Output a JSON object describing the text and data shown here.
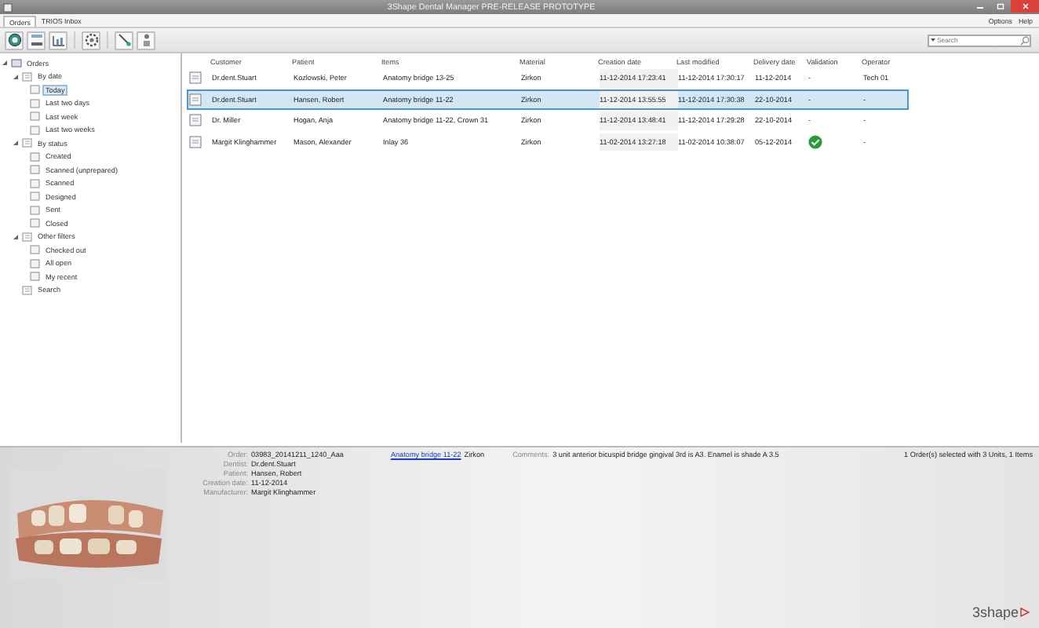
{
  "window": {
    "title": "3Shape Dental Manager PRE-RELEASE PROTOTYPE"
  },
  "tabs": [
    {
      "label": "Orders",
      "selected": true
    },
    {
      "label": "TRIOS Inbox",
      "selected": false
    }
  ],
  "menu": [
    "Options",
    "Help"
  ],
  "search": {
    "placeholder": "Search"
  },
  "tree": {
    "label": "Orders",
    "expanded": true,
    "selected": false,
    "children": [
      {
        "label": "By date",
        "expanded": true,
        "selected": false,
        "children": [
          {
            "label": "Today",
            "selected": true
          },
          {
            "label": "Last two days",
            "selected": false
          },
          {
            "label": "Last week",
            "selected": false
          },
          {
            "label": "Last two weeks",
            "selected": false
          }
        ]
      },
      {
        "label": "By status",
        "expanded": true,
        "selected": false,
        "children": [
          {
            "label": "Created",
            "selected": false
          },
          {
            "label": "Scanned (unprepared)",
            "selected": false
          },
          {
            "label": "Scanned",
            "selected": false
          },
          {
            "label": "Designed",
            "selected": false
          },
          {
            "label": "Sent",
            "selected": false
          },
          {
            "label": "Closed",
            "selected": false
          }
        ]
      },
      {
        "label": "Other filters",
        "expanded": true,
        "selected": false,
        "children": [
          {
            "label": "Checked out",
            "selected": false
          },
          {
            "label": "All open",
            "selected": false
          },
          {
            "label": "My recent",
            "selected": false
          }
        ]
      },
      {
        "label": "Search",
        "selected": false
      }
    ]
  },
  "table": {
    "columns": [
      "Customer",
      "Patient",
      "Items",
      "Material",
      "Creation date",
      "Last modified",
      "Delivery date",
      "Validation",
      "Operator"
    ],
    "rows": [
      {
        "selected": false,
        "cells": [
          "Dr.dent.Stuart",
          "Kozlowski, Peter",
          "Anatomy bridge 13-25",
          "Zirkon",
          "11-12-2014 17:23:41",
          "11-12-2014 17:30:17",
          "11-12-2014"
        ],
        "validation": {
          "kind": "text",
          "text": "-"
        },
        "operator": "Tech 01"
      },
      {
        "selected": true,
        "cells": [
          "Dr.dent.Stuart",
          "Hansen, Robert",
          "Anatomy bridge 11-22",
          "Zirkon",
          "11-12-2014 13:55:55",
          "11-12-2014 17:30:38",
          "22-10-2014"
        ],
        "validation": {
          "kind": "text",
          "text": "-"
        },
        "operator": "-"
      },
      {
        "selected": false,
        "cells": [
          "Dr. Miller",
          "Hogan, Anja",
          "Anatomy bridge 11-22, Crown 31",
          "Zirkon",
          "11-12-2014 13:48:41",
          "11-12-2014 17:29:28",
          "22-10-2014"
        ],
        "validation": {
          "kind": "text",
          "text": "-"
        },
        "operator": "-"
      },
      {
        "selected": false,
        "cells": [
          "Margit Klinghammer",
          "Mason, Alexander",
          "Inlay 36",
          "Zirkon",
          "11-02-2014 13:27:18",
          "11-02-2014 10:38:07",
          "05-12-2014"
        ],
        "validation": {
          "kind": "check"
        },
        "operator": "-"
      }
    ]
  },
  "details": {
    "fields": [
      {
        "label": "Order:",
        "value": "03983_20141211_1240_Aaa"
      },
      {
        "label": "Dentist:",
        "value": "Dr.dent.Stuart"
      },
      {
        "label": "Patient:",
        "value": "Hansen, Robert"
      },
      {
        "label": "Creation date:",
        "value": "11-12-2014"
      },
      {
        "label": "Manufacturer:",
        "value": "Margit Klinghammer"
      }
    ],
    "item_link": "Anatomy bridge 11-22",
    "material": "Zirkon",
    "comments_label": "Comments:",
    "comments": "3 unit anterior bicuspid bridge gingival 3rd is A3. Enamel is shade A 3.5",
    "summary": "1 Order(s) selected with 3 Units, 1 Items"
  },
  "logo": "3shape"
}
